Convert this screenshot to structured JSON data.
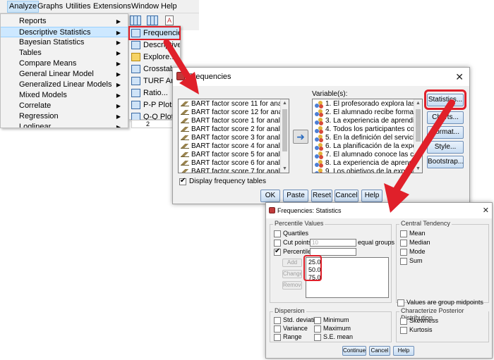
{
  "menubar": {
    "items": [
      "Analyze",
      "Graphs",
      "Utilities",
      "Extensions",
      "Window",
      "Help"
    ]
  },
  "analyze_menu": {
    "items": [
      "Reports",
      "Descriptive Statistics",
      "Bayesian Statistics",
      "Tables",
      "Compare Means",
      "General Linear Model",
      "Generalized Linear Models",
      "Mixed Models",
      "Correlate",
      "Regression",
      "Loglinear"
    ]
  },
  "submenu": {
    "items": [
      "Frequencies...",
      "Descriptives...",
      "Explore...",
      "Crosstabs...",
      "TURF Analysis",
      "Ratio...",
      "P-P Plots...",
      "Q-Q Plots..."
    ]
  },
  "row_number": "2",
  "frequencies_dialog": {
    "title": "Frequencies",
    "variables_label": "Variable(s):",
    "source_items": [
      "BART factor score  11 for analysis...",
      "BART factor score  12 for analysis...",
      "BART factor score   1 for analysis ...",
      "BART factor score   2 for analysis ...",
      "BART factor score   3 for analysis ...",
      "BART factor score   4 for analysis ...",
      "BART factor score   5 for analysis ...",
      "BART factor score   6 for analysis ...",
      "BART factor score   7 for analysis ..."
    ],
    "target_items": [
      "1. El profesorado explora las exp...",
      "2. El alumnado recibe formación ...",
      "3. La experiencia de aprendizaje-...",
      "4. Todos los participantes colabo...",
      "5. En la definición del servicio se ...",
      "6. La planificación de la experien...",
      "7. El alumnado conoce las caract...",
      "8. La experiencia de aprendizaje...",
      "9. Los objetivos de la experiencia..."
    ],
    "side_buttons": [
      "Statistics...",
      "Charts...",
      "Format...",
      "Style...",
      "Bootstrap..."
    ],
    "display_tables_label": "Display frequency tables",
    "bottom_buttons": [
      "OK",
      "Paste",
      "Reset",
      "Cancel",
      "Help"
    ]
  },
  "stats_dialog": {
    "title": "Frequencies: Statistics",
    "percentile_values": {
      "title": "Percentile Values",
      "quartiles": "Quartiles",
      "cut_points": "Cut points for:",
      "cut_points_value": "10",
      "equal_groups": "equal groups",
      "percentiles": "Percentile(s):",
      "percentile_list": [
        "25.0",
        "50.0",
        "75.0"
      ],
      "add": "Add",
      "change": "Change",
      "remove": "Remove"
    },
    "central_tendency": {
      "title": "Central Tendency",
      "items": [
        "Mean",
        "Median",
        "Mode",
        "Sum"
      ]
    },
    "group_midpoints": "Values are group midpoints",
    "dispersion": {
      "title": "Dispersion",
      "items": [
        "Std. deviation",
        "Minimum",
        "Variance",
        "Maximum",
        "Range",
        "S.E. mean"
      ]
    },
    "posterior": {
      "title": "Characterize Posterior Distribution",
      "items": [
        "Skewness",
        "Kurtosis"
      ]
    },
    "buttons": [
      "Continue",
      "Cancel",
      "Help"
    ]
  },
  "colors": {
    "highlight_red": "#e0202a",
    "menu_highlight": "#cde8ff"
  }
}
